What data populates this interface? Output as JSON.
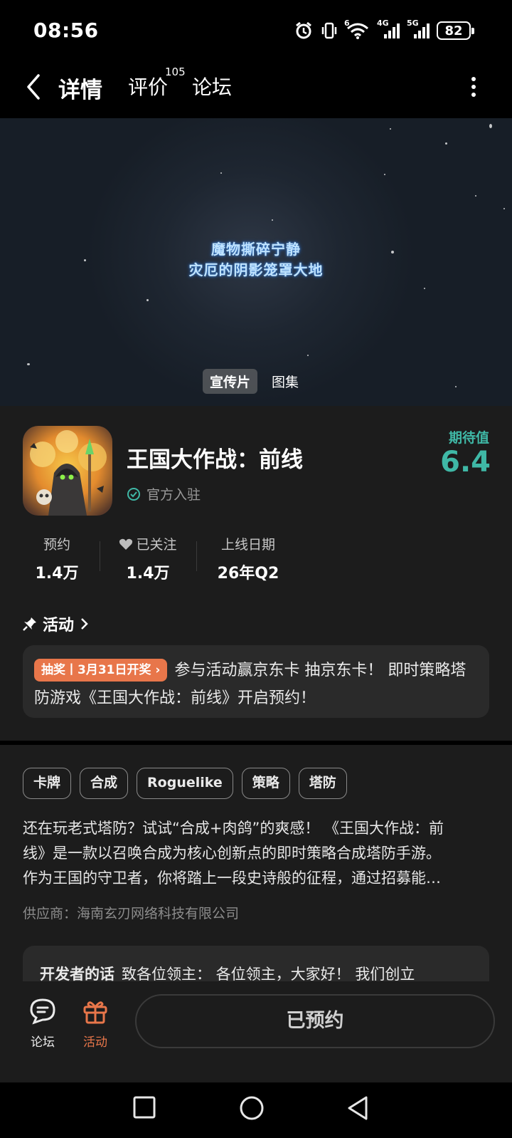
{
  "status_bar": {
    "time": "08:56",
    "battery": "82",
    "net1": "4G",
    "net2": "5G",
    "wifi_badge": "6"
  },
  "nav": {
    "tabs": [
      {
        "label": "详情"
      },
      {
        "label": "评价"
      },
      {
        "label": "论坛"
      }
    ],
    "review_count": "105"
  },
  "media": {
    "line1": "魔物撕碎宁静",
    "line2": "灾厄的阴影笼罩大地",
    "tabs": [
      "宣传片",
      "图集"
    ]
  },
  "app": {
    "name": "王国大作战：前线",
    "verified": "官方入驻",
    "expect_label": "期待值",
    "expect_value": "6.4",
    "stats": [
      {
        "label": "预约",
        "value": "1.4万"
      },
      {
        "label": "已关注",
        "value": "1.4万"
      },
      {
        "label": "上线日期",
        "value": "26年Q2"
      }
    ]
  },
  "activity": {
    "title": "活动",
    "badge": "抽奖丨3月31日开奖",
    "text": "参与活动赢京东卡 抽京东卡！ 即时策略塔防游戏《王国大作战：前线》开启预约！"
  },
  "description": {
    "tags": [
      "卡牌",
      "合成",
      "Roguelike",
      "策略",
      "塔防"
    ],
    "text_lines": [
      "还在玩老式塔防？试试“合成+肉鸽”的爽感！ 《王国大作战：前",
      "线》是一款以召唤合成为核心创新点的即时策略合成塔防手游。",
      "作为王国的守卫者，你将踏上一段史诗般的征程，通过招募能…"
    ],
    "vendor": "供应商：海南玄刃网络科技有限公司",
    "dev_title": "开发者的话",
    "dev_text": "致各位领主： 各位领主，大家好！ 我们创立"
  },
  "action_bar": {
    "forum_label": "论坛",
    "activity_label": "活动",
    "reserve_label": "已预约"
  },
  "colors": {
    "accent": "#3fb8a6",
    "orange": "#e8764a",
    "card": "#1c1c1c",
    "subcard": "#2a2a2a"
  }
}
